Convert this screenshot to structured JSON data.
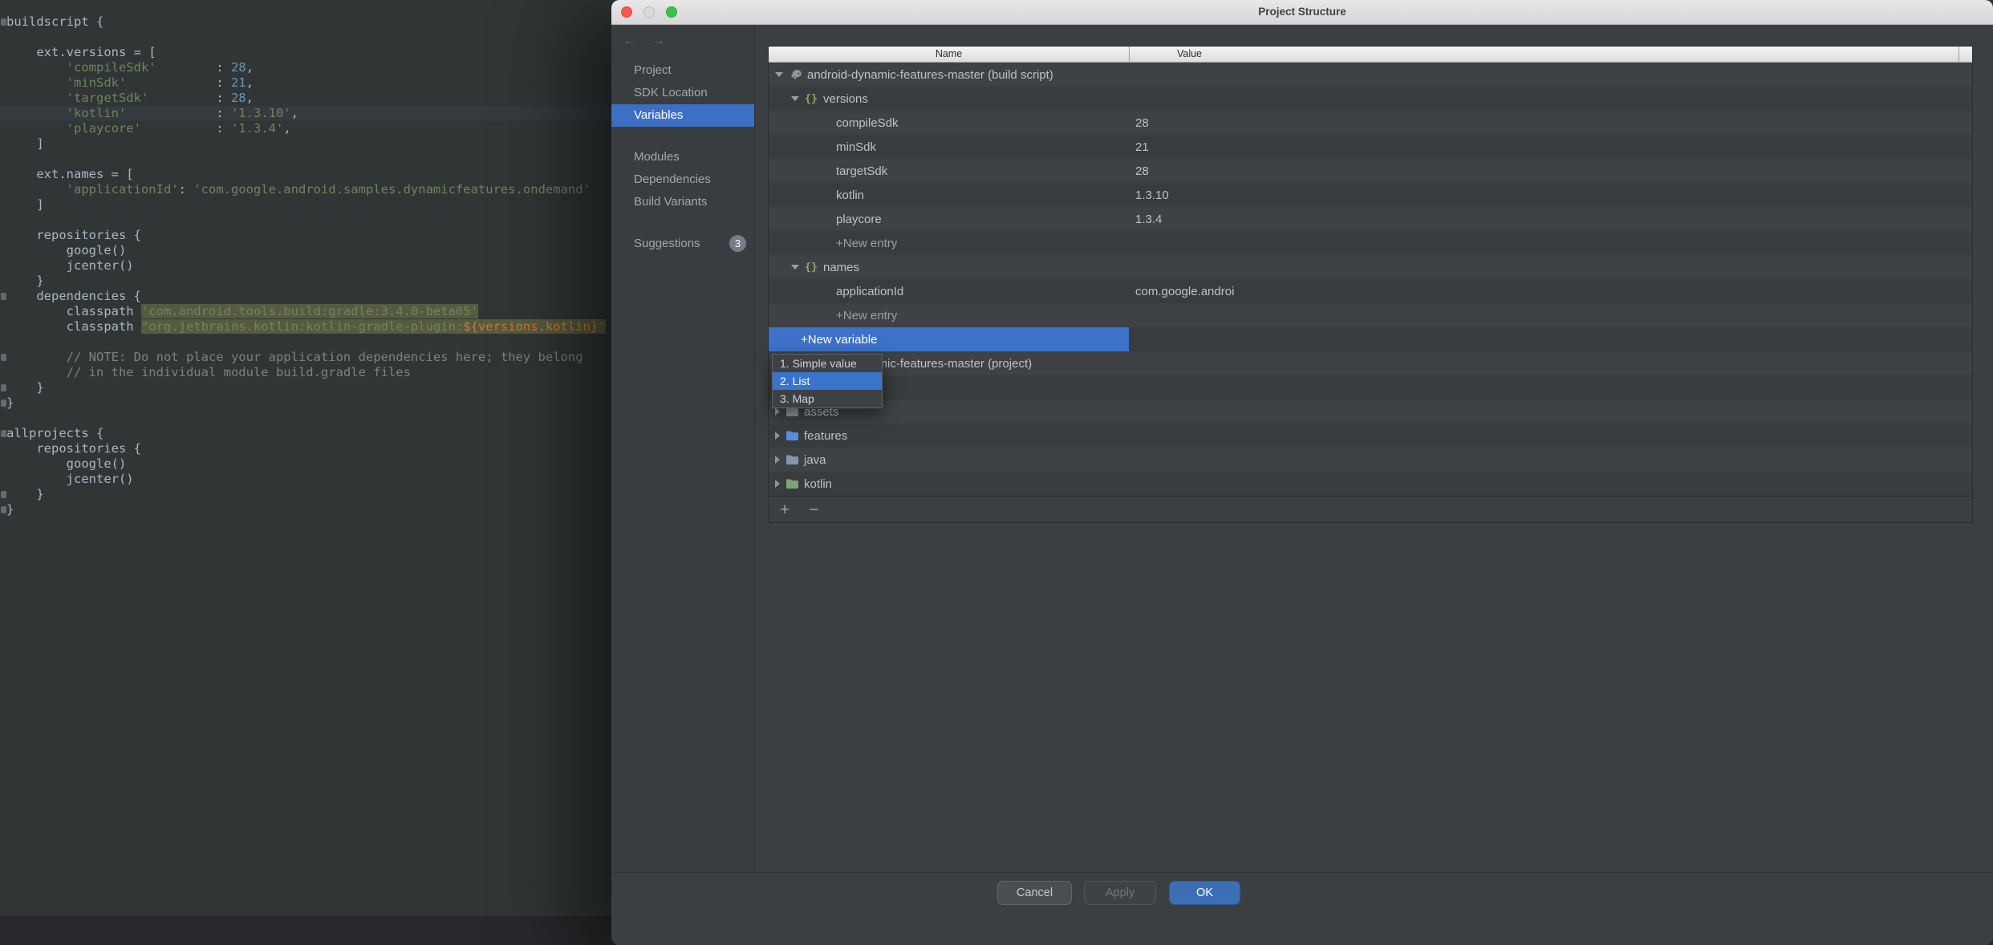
{
  "colors": {
    "accent_blue": "#3C72C9",
    "editor_background": "#313536",
    "dialog_background": "#3C3F41",
    "string_green": "#6A8759",
    "number_blue": "#6897BB",
    "comment_gray": "#808080",
    "selection_olive": "#565B40",
    "ok_button_blue": "#3C6EB5",
    "traffic_close_red": "#F6594E",
    "traffic_minimize_gray": "#DCD9DC",
    "traffic_zoom_green": "#32C746"
  },
  "editor": {
    "current_line": 6,
    "fold_mark_lines": [
      0,
      18,
      22,
      24,
      25,
      27,
      31,
      32
    ],
    "code_lines": [
      [
        [
          "p",
          "buildscript {"
        ]
      ],
      [],
      [
        [
          "p",
          "    ext.versions = ["
        ]
      ],
      [
        [
          "p",
          "        "
        ],
        [
          "s",
          "'compileSdk'"
        ],
        [
          "p",
          "        : "
        ],
        [
          "n",
          "28"
        ],
        [
          "p",
          ","
        ]
      ],
      [
        [
          "p",
          "        "
        ],
        [
          "s",
          "'minSdk'"
        ],
        [
          "p",
          "            : "
        ],
        [
          "n",
          "21"
        ],
        [
          "p",
          ","
        ]
      ],
      [
        [
          "p",
          "        "
        ],
        [
          "s",
          "'targetSdk'"
        ],
        [
          "p",
          "         : "
        ],
        [
          "n",
          "28"
        ],
        [
          "p",
          ","
        ]
      ],
      [
        [
          "p",
          "        "
        ],
        [
          "s",
          "'kotlin'"
        ],
        [
          "p",
          "            : "
        ],
        [
          "s",
          "'1.3.10'"
        ],
        [
          "p",
          ","
        ]
      ],
      [
        [
          "p",
          "        "
        ],
        [
          "s",
          "'playcore'"
        ],
        [
          "p",
          "          : "
        ],
        [
          "s",
          "'1.3.4'"
        ],
        [
          "p",
          ","
        ]
      ],
      [
        [
          "p",
          "    ]"
        ]
      ],
      [],
      [
        [
          "p",
          "    ext.names = ["
        ]
      ],
      [
        [
          "p",
          "        "
        ],
        [
          "s",
          "'applicationId'"
        ],
        [
          "p",
          ": "
        ],
        [
          "s",
          "'com.google.android.samples.dynamicfeatures.ondemand'"
        ]
      ],
      [
        [
          "p",
          "    ]"
        ]
      ],
      [],
      [
        [
          "p",
          "    repositories {"
        ]
      ],
      [
        [
          "p",
          "        google()"
        ]
      ],
      [
        [
          "p",
          "        jcenter()"
        ]
      ],
      [
        [
          "p",
          "    }"
        ]
      ],
      [
        [
          "p",
          "    dependencies {"
        ]
      ],
      [
        [
          "p",
          "        classpath "
        ],
        [
          "ssel",
          "'com.android.tools.build:gradle:3.4.0-beta05'"
        ]
      ],
      [
        [
          "p",
          "        classpath "
        ],
        [
          "ssel",
          "\"org.jetbrains.kotlin:kotlin-gradle-plugin:"
        ],
        [
          "tsel",
          "${versions.kotlin}"
        ],
        [
          "ssel",
          "\""
        ]
      ],
      [],
      [
        [
          "c",
          "        // NOTE: Do not place your application dependencies here; they belong"
        ]
      ],
      [
        [
          "c",
          "        // in the individual module build.gradle files"
        ]
      ],
      [
        [
          "p",
          "    }"
        ]
      ],
      [
        [
          "p",
          "}"
        ]
      ],
      [],
      [
        [
          "p",
          "allprojects {"
        ]
      ],
      [
        [
          "p",
          "    repositories {"
        ]
      ],
      [
        [
          "p",
          "        google()"
        ]
      ],
      [
        [
          "p",
          "        jcenter()"
        ]
      ],
      [
        [
          "p",
          "    }"
        ]
      ],
      [
        [
          "p",
          "}"
        ]
      ]
    ]
  },
  "dialog": {
    "title": "Project Structure",
    "nav_arrows": {
      "back": "←",
      "forward": "→"
    },
    "sidebar": {
      "items": [
        {
          "label": "Project"
        },
        {
          "label": "SDK Location"
        },
        {
          "label": "Variables",
          "selected": true
        },
        {
          "label": "Modules",
          "gap_before": true
        },
        {
          "label": "Dependencies"
        },
        {
          "label": "Build Variants"
        },
        {
          "label": "Suggestions",
          "gap_before": true,
          "badge": "3"
        }
      ]
    },
    "table": {
      "columns": [
        "Name",
        "Value"
      ],
      "rows": [
        {
          "kind": "group",
          "indent": 0,
          "arrow": "down",
          "icon": "gradle",
          "name": "android-dynamic-features-master (build script)"
        },
        {
          "kind": "group",
          "indent": 1,
          "arrow": "down",
          "icon": "braces",
          "name": "versions"
        },
        {
          "kind": "entry",
          "indent": 2,
          "name": "compileSdk",
          "value": "28"
        },
        {
          "kind": "entry",
          "indent": 2,
          "name": "minSdk",
          "value": "21"
        },
        {
          "kind": "entry",
          "indent": 2,
          "name": "targetSdk",
          "value": "28"
        },
        {
          "kind": "entry",
          "indent": 2,
          "name": "kotlin",
          "value": "1.3.10"
        },
        {
          "kind": "entry",
          "indent": 2,
          "name": "playcore",
          "value": "1.3.4"
        },
        {
          "kind": "new",
          "indent": 2,
          "name": "+New entry"
        },
        {
          "kind": "group",
          "indent": 1,
          "arrow": "down",
          "icon": "braces",
          "name": "names"
        },
        {
          "kind": "entry",
          "indent": 2,
          "name": "applicationId",
          "value": "com.google.androi"
        },
        {
          "kind": "new",
          "indent": 2,
          "name": "+New entry"
        },
        {
          "kind": "newvar",
          "indent": 1,
          "name": "+New variable"
        },
        {
          "kind": "group",
          "indent": 0,
          "arrow": "down",
          "icon": "gradle",
          "name": "android-dynamic-features-master (project)"
        },
        {
          "kind": "empty"
        },
        {
          "kind": "folder",
          "indent": 0,
          "arrow": "right",
          "icon": "folder-assets",
          "name": "assets"
        },
        {
          "kind": "folder",
          "indent": 0,
          "arrow": "right",
          "icon": "folder-features",
          "name": "features"
        },
        {
          "kind": "folder",
          "indent": 0,
          "arrow": "right",
          "icon": "folder-java",
          "name": "java"
        },
        {
          "kind": "folder",
          "indent": 0,
          "arrow": "right",
          "icon": "folder-kotlin",
          "name": "kotlin"
        }
      ]
    },
    "popup": {
      "items": [
        "1. Simple value",
        "2. List",
        "3. Map"
      ],
      "selected_index": 1
    },
    "table_toolbar": {
      "add": "+",
      "remove": "−"
    },
    "footer": {
      "cancel_label": "Cancel",
      "apply_label": "Apply",
      "ok_label": "OK"
    }
  }
}
